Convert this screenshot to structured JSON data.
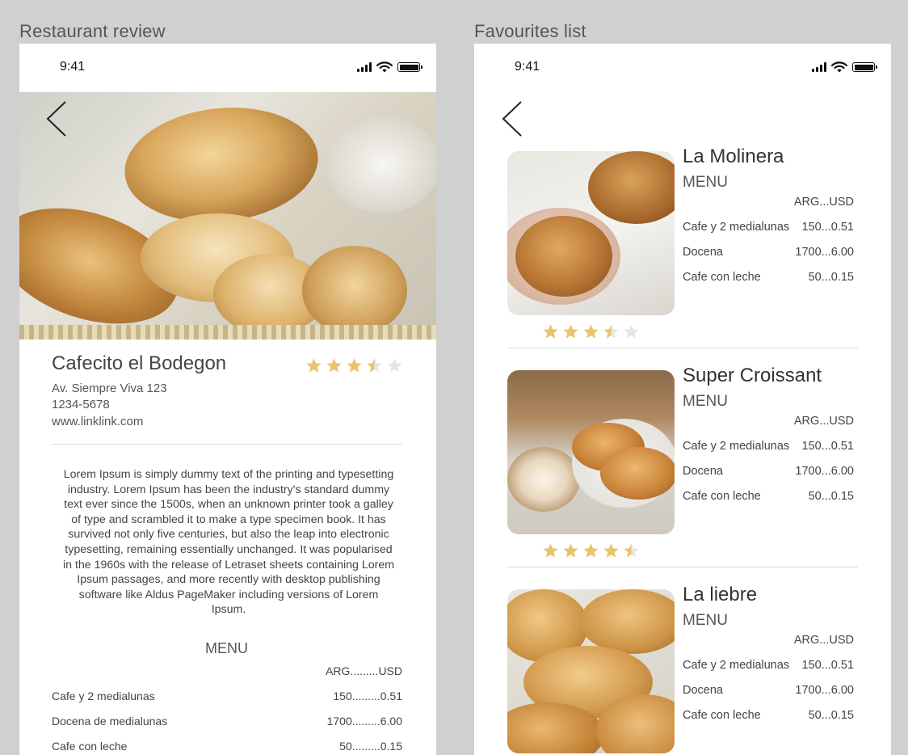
{
  "frames": {
    "review_label": "Restaurant review",
    "favourites_label": "Favourites list"
  },
  "status": {
    "time": "9:41"
  },
  "colors": {
    "star_filled": "#e9c46a",
    "star_empty": "#e6e6e6",
    "background": "#d0d0d0"
  },
  "review": {
    "name": "Cafecito el Bodegon",
    "rating": 3.5,
    "address": "Av. Siempre Viva 123",
    "phone": "1234-5678",
    "website": "www.linklink.com",
    "description": "Lorem Ipsum is simply dummy text of the printing and typesetting industry. Lorem Ipsum has been the industry's standard dummy text ever since the 1500s, when an unknown printer took a galley of type and scrambled it to make a type specimen book. It has survived not only five centuries, but also the leap into electronic typesetting, remaining essentially unchanged. It was popularised in the 1960s with the release of Letraset sheets containing Lorem Ipsum passages, and more recently with desktop publishing software like Aldus PageMaker including versions of Lorem Ipsum.",
    "menu_title": "MENU",
    "currency_header": "ARG.........USD",
    "menu_items": [
      {
        "name": "Cafe y 2 medialunas",
        "price": "150.........0.51"
      },
      {
        "name": "Docena de medialunas",
        "price": "1700.........6.00"
      },
      {
        "name": "Cafe con leche",
        "price": "50.........0.15"
      }
    ]
  },
  "favourites": [
    {
      "name": "La Molinera",
      "rating": 3.5,
      "menu_title": "MENU",
      "currency_header": "ARG...USD",
      "items": [
        {
          "name": "Cafe y 2 medialunas",
          "price": "150...0.51"
        },
        {
          "name": "Docena",
          "price": "1700...6.00"
        },
        {
          "name": "Cafe con leche",
          "price": "50...0.15"
        }
      ]
    },
    {
      "name": "Super Croissant",
      "rating": 4.5,
      "menu_title": "MENU",
      "currency_header": "ARG...USD",
      "items": [
        {
          "name": "Cafe y 2 medialunas",
          "price": "150...0.51"
        },
        {
          "name": "Docena",
          "price": "1700...6.00"
        },
        {
          "name": "Cafe con leche",
          "price": "50...0.15"
        }
      ]
    },
    {
      "name": "La liebre",
      "menu_title": "MENU",
      "currency_header": "ARG...USD",
      "items": [
        {
          "name": "Cafe y 2 medialunas",
          "price": "150...0.51"
        },
        {
          "name": "Docena",
          "price": "1700...6.00"
        },
        {
          "name": "Cafe con leche",
          "price": "50...0.15"
        }
      ]
    }
  ]
}
